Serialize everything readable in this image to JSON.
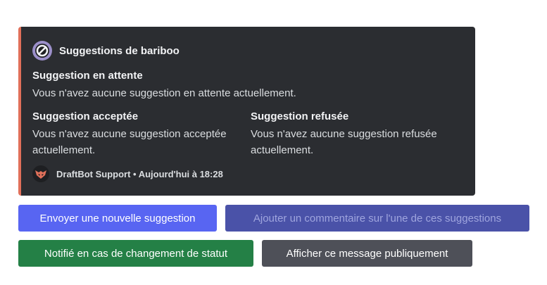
{
  "embed": {
    "accent_color": "#e1705a",
    "author": {
      "icon": "blocked-circle-icon",
      "name": "Suggestions de bariboo"
    },
    "fields": [
      {
        "name": "Suggestion en attente",
        "value": "Vous n'avez aucune suggestion en attente actuellement."
      },
      {
        "name": "Suggestion acceptée",
        "value": "Vous n'avez aucune suggestion acceptée actuellement."
      },
      {
        "name": "Suggestion refusée",
        "value": "Vous n'avez aucune suggestion refusée actuellement."
      }
    ],
    "footer": {
      "icon": "draftbot-logo-icon",
      "text": "DraftBot Support • Aujourd'hui à 18:28"
    }
  },
  "buttons": {
    "new_suggestion": "Envoyer une nouvelle suggestion",
    "add_comment": "Ajouter un commentaire sur l'une de ces suggestions",
    "notify_status": "Notifié en cas de changement de statut",
    "show_public": "Afficher ce message publiquement"
  },
  "colors": {
    "primary": "#5865f2",
    "success": "#248046",
    "secondary": "#4e5058"
  }
}
